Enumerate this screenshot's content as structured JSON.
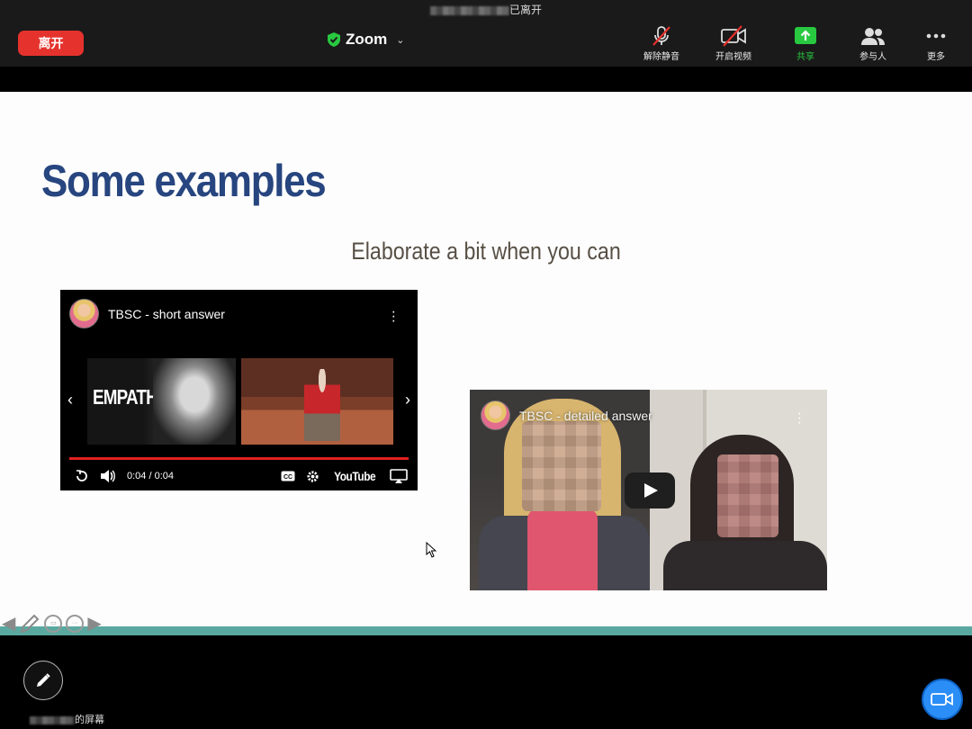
{
  "meeting": {
    "participant_left_text": "已离开",
    "leave_label": "离开",
    "app_title": "Zoom"
  },
  "controls": [
    {
      "label": "解除静音",
      "icon": "muted-microphone-icon"
    },
    {
      "label": "开启视频",
      "icon": "video-off-icon"
    },
    {
      "label": "共享",
      "icon": "share-screen-icon",
      "color": "#28c840"
    },
    {
      "label": "参与人",
      "icon": "participants-icon"
    },
    {
      "label": "更多",
      "icon": "more-icon"
    }
  ],
  "slide": {
    "title": "Some examples",
    "subtitle": "Elaborate a bit when you can",
    "video1": {
      "title": "TBSC - short answer",
      "thumb_text": "EMPATHY",
      "time": "0:04 / 0:04",
      "brand": "YouTube"
    },
    "video2": {
      "title": "TBSC - detailed answer"
    }
  },
  "bottom": {
    "screen_owner_suffix": "的屏幕"
  },
  "colors": {
    "leave": "#e5322d",
    "share": "#28c840",
    "title_blue": "#27457f",
    "teal": "#5aa9a0",
    "camera": "#2b8ef6"
  }
}
